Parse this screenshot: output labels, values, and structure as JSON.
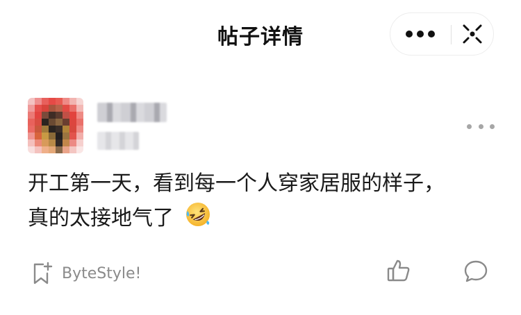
{
  "header": {
    "title": "帖子详情",
    "more_icon": "more-dots-icon",
    "close_icon": "close-target-icon"
  },
  "post": {
    "author_avatar": "avatar-pixelated",
    "text": "开工第一天，看到每一个人穿家居服的样子，\n真的太接地气了",
    "emoji": "rolling-on-floor-laughing"
  },
  "footer": {
    "brand_icon": "bookmark-plus-icon",
    "brand_label": "ByteStyle!",
    "like_icon": "thumbs-up-icon",
    "comment_icon": "comment-icon"
  },
  "colors": {
    "text": "#1a1a1a",
    "muted": "#8a8a8a"
  }
}
